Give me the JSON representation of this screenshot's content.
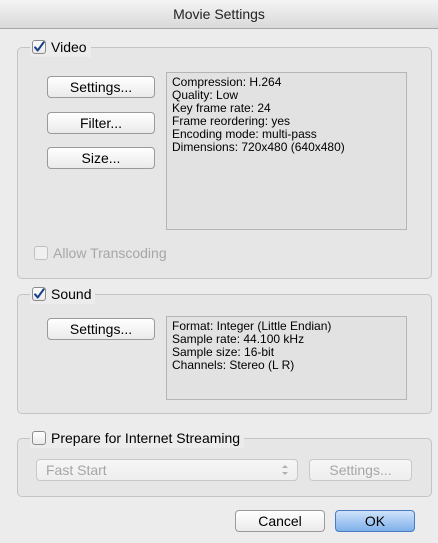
{
  "window": {
    "title": "Movie Settings"
  },
  "video": {
    "label": "Video",
    "checked": true,
    "buttons": {
      "settings": "Settings...",
      "filter": "Filter...",
      "size": "Size..."
    },
    "info": [
      "Compression: H.264",
      "Quality: Low",
      "Key frame rate: 24",
      "Frame reordering: yes",
      "Encoding mode: multi-pass",
      "Dimensions: 720x480 (640x480)"
    ],
    "allow_transcoding": {
      "label": "Allow Transcoding",
      "checked": false,
      "enabled": false
    }
  },
  "sound": {
    "label": "Sound",
    "checked": true,
    "buttons": {
      "settings": "Settings..."
    },
    "info": [
      "Format: Integer (Little Endian)",
      "Sample rate: 44.100 kHz",
      "Sample size: 16-bit",
      "Channels: Stereo (L R)"
    ]
  },
  "streaming": {
    "label": "Prepare for Internet Streaming",
    "checked": false,
    "select_value": "Fast Start",
    "settings_label": "Settings...",
    "enabled": false
  },
  "footer": {
    "cancel": "Cancel",
    "ok": "OK"
  },
  "colors": {
    "default_button": "#7fb0ea",
    "checkmark": "#1a3f8a",
    "disabled_text": "#a6a6a6"
  }
}
